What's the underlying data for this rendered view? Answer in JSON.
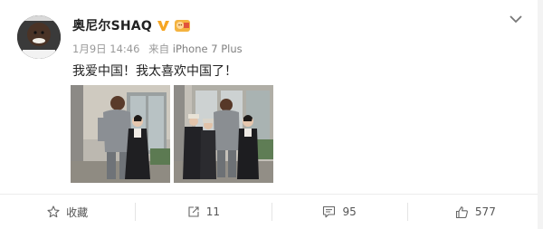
{
  "post": {
    "username": "奥尼尔SHAQ",
    "date": "1月9日 14:46",
    "from_label": "来自",
    "device": "iPhone 7 Plus",
    "text": "我爱中国！我太喜欢中国了！"
  },
  "icons": {
    "avatar": "avatar",
    "verified": "vip-v-badge-icon",
    "emoji": "emoji-badge-icon",
    "more": "chevron-down-icon",
    "favorite": "star-icon",
    "repost": "share-arrow-icon",
    "comment": "comment-icon",
    "like": "thumbs-up-icon"
  },
  "actions": {
    "favorite_label": "收藏",
    "repost_count": "11",
    "comment_count": "95",
    "like_count": "577"
  },
  "colors": {
    "verified_orange": "#f6a623",
    "meta_gray": "#999999"
  }
}
